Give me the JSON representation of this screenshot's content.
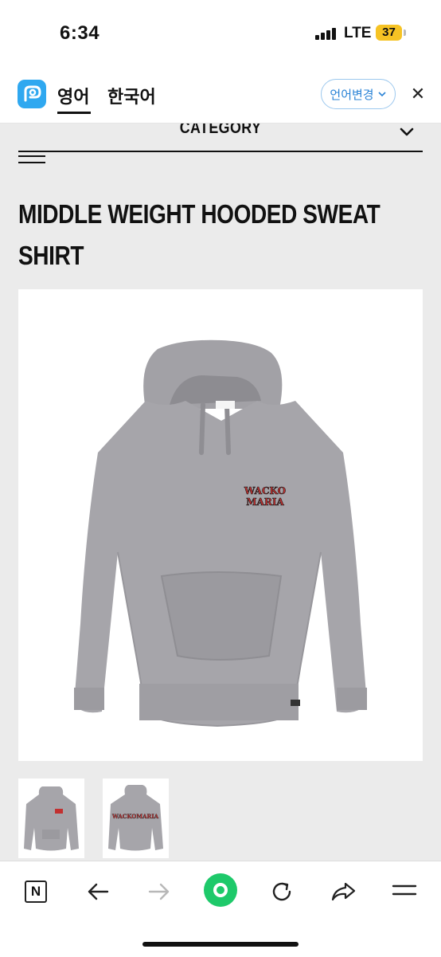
{
  "status_bar": {
    "time": "6:34",
    "network": "LTE",
    "battery": "37"
  },
  "translate_bar": {
    "tabs": [
      {
        "label": "영어"
      },
      {
        "label": "한국어"
      }
    ],
    "change_language_label": "언어변경",
    "chevron_glyph": "⌄",
    "close_glyph": "✕"
  },
  "page": {
    "category_label": "CATEGORY",
    "product_title_line1": "MIDDLE WEIGHT HOODED SWEAT",
    "product_title_line2": "SHIRT",
    "main_image": {
      "print_text_line1": "WACKO",
      "print_text_line2": "MARIA"
    },
    "thumbnails": [
      {
        "print_text": ""
      },
      {
        "print_text": "WACKOMARIA"
      }
    ]
  },
  "toolbar": {
    "icons": [
      "naver-n-icon",
      "back-arrow-icon",
      "forward-arrow-icon",
      "green-dot-icon",
      "refresh-icon",
      "share-icon",
      "menu-icon"
    ],
    "naver_glyph": "N"
  },
  "colors": {
    "accent_green": "#1ec96a",
    "papago_blue": "#2fa8f0",
    "link_blue": "#2a83d6",
    "battery_yellow": "#f6c324",
    "hoodie_gray": "#a4a3a8",
    "print_red": "#c23030"
  }
}
